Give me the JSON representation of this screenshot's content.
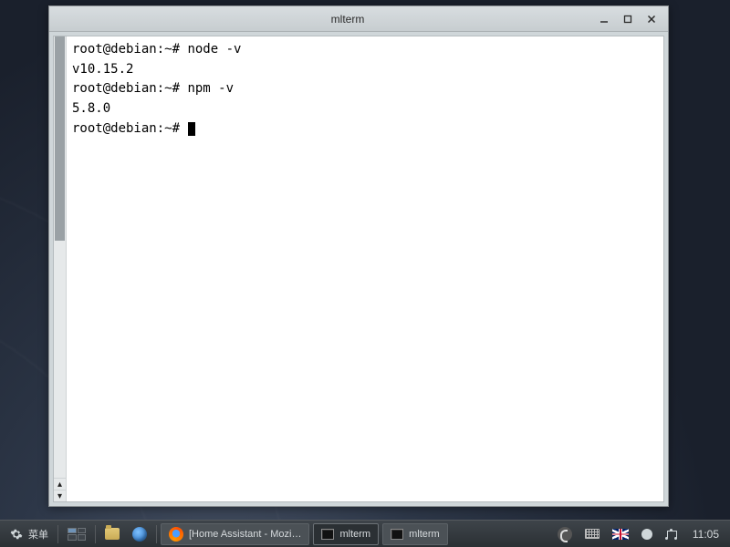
{
  "window": {
    "title": "mlterm"
  },
  "terminal": {
    "lines": [
      {
        "prompt": "root@debian:~# ",
        "cmd": "node -v"
      },
      {
        "out": "v10.15.2"
      },
      {
        "prompt": "root@debian:~# ",
        "cmd": "npm -v"
      },
      {
        "out": "5.8.0"
      },
      {
        "prompt": "root@debian:~# ",
        "cursor": true
      }
    ]
  },
  "panel": {
    "menu_label": "菜单",
    "tasks": [
      {
        "label": "[Home Assistant - Mozi…",
        "icon": "firefox"
      },
      {
        "label": "mlterm",
        "icon": "terminal",
        "active": true
      },
      {
        "label": "mlterm",
        "icon": "terminal"
      }
    ],
    "locale_flag": "UK",
    "clock": "11:05"
  }
}
